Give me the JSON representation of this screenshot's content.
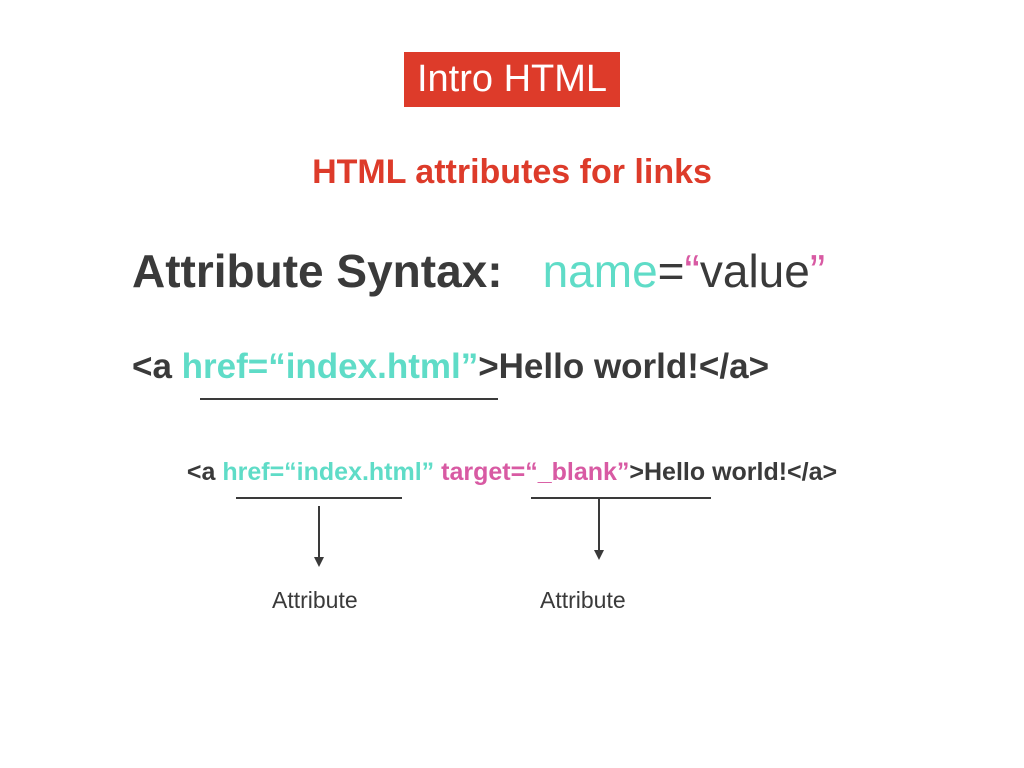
{
  "header": {
    "title": "Intro HTML"
  },
  "subtitle": "HTML attributes for links",
  "syntax": {
    "label": "Attribute Syntax:",
    "name": "name",
    "equals": "=",
    "open_quote": "“",
    "value": "value",
    "close_quote": "”"
  },
  "example1": {
    "open": "<a ",
    "href_attr": "href=“index.html”",
    "rest": ">Hello world!</a>"
  },
  "example2": {
    "open": "<a ",
    "href_attr": "href=“index.html”",
    "target_attr": "target=“_blank”",
    "rest": ">Hello world!</a>"
  },
  "annotations": [
    "Attribute",
    "Attribute"
  ],
  "colors": {
    "accent": "#dd3b2a",
    "attribute_teal": "#5fdcc7",
    "attribute_pink": "#d85aa3",
    "text_dark": "#3a3a3a"
  }
}
